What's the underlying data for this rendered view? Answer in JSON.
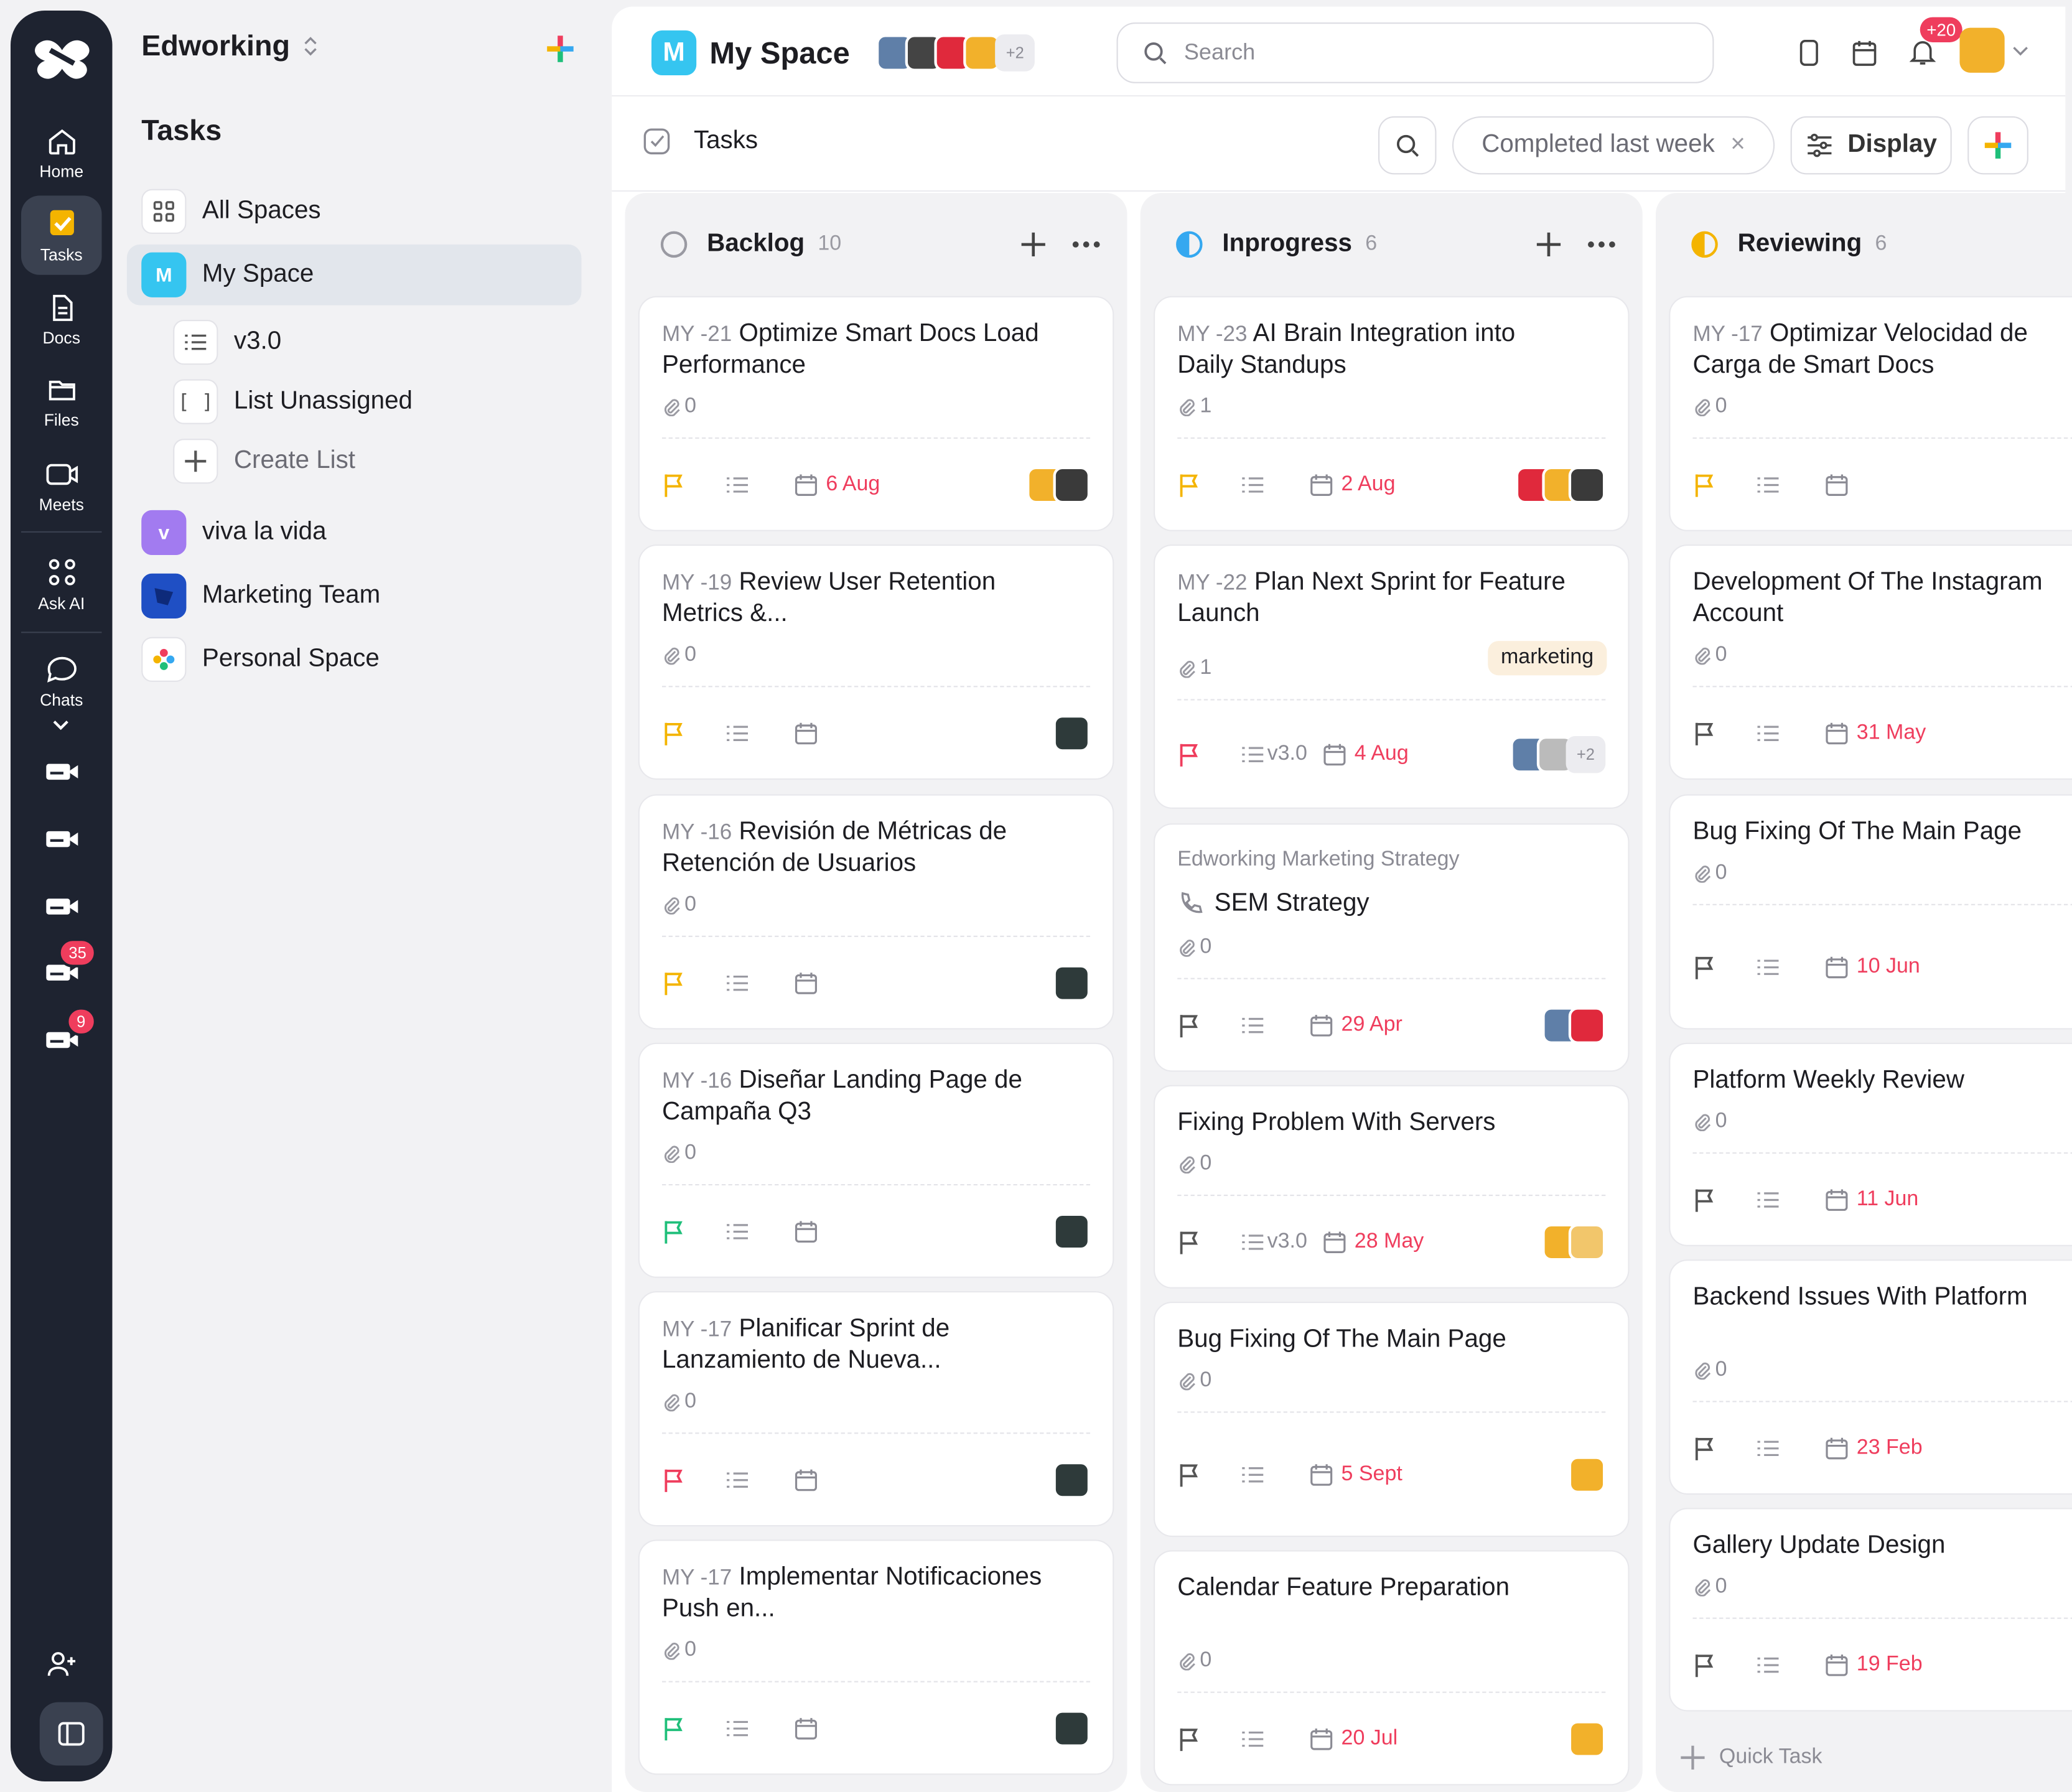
{
  "rail": {
    "items": [
      {
        "label": "Home",
        "icon": "home-icon"
      },
      {
        "label": "Tasks",
        "icon": "tasks-icon"
      },
      {
        "label": "Docs",
        "icon": "docs-icon"
      },
      {
        "label": "Files",
        "icon": "files-icon"
      },
      {
        "label": "Meets",
        "icon": "meets-icon"
      },
      {
        "label": "Ask AI",
        "icon": "ask-ai-icon"
      },
      {
        "label": "Chats",
        "icon": "chats-icon"
      }
    ],
    "badges": [
      "35",
      "9"
    ]
  },
  "sidebar": {
    "workspace": "Edworking",
    "section": "Tasks",
    "items": [
      {
        "label": "All Spaces"
      },
      {
        "label": "My Space",
        "badge": "M"
      },
      {
        "label": "v3.0"
      },
      {
        "label": "List Unassigned",
        "icon_text": "[ ]"
      },
      {
        "label": "Create List"
      },
      {
        "label": "viva la vida",
        "badge": "v"
      },
      {
        "label": "Marketing Team"
      },
      {
        "label": "Personal Space"
      }
    ]
  },
  "header": {
    "title": "My Space",
    "badge": "M",
    "members_more": "+2",
    "search_placeholder": "Search",
    "notif_badge": "+20"
  },
  "toolbar": {
    "title": "Tasks",
    "filter": "Completed last week",
    "filter_close": "×",
    "display": "Display"
  },
  "columns": [
    {
      "name": "Backlog",
      "count": "10",
      "cards": [
        {
          "id": "MY -21",
          "title": "Optimize Smart Docs Load Performance",
          "attachments": "0",
          "date": "6 Aug"
        },
        {
          "id": "MY -19",
          "title": "Review User Retention Metrics &...",
          "attachments": "0",
          "date": ""
        },
        {
          "id": "MY -16",
          "title": "Revisión de Métricas de Retención de Usuarios",
          "attachments": "0",
          "date": ""
        },
        {
          "id": "MY -16",
          "title": "Diseñar Landing Page de Campaña Q3",
          "attachments": "0",
          "date": ""
        },
        {
          "id": "MY -17",
          "title": "Planificar Sprint de Lanzamiento de Nueva...",
          "attachments": "0",
          "date": ""
        },
        {
          "id": "MY -17",
          "title": "Implementar Notificaciones Push en...",
          "attachments": "0",
          "date": ""
        }
      ]
    },
    {
      "name": "Inprogress",
      "count": "6",
      "cards": [
        {
          "id": "MY -23",
          "title": "AI Brain Integration into Daily Standups",
          "attachments": "1",
          "date": "2 Aug"
        },
        {
          "id": "MY -22",
          "title": "Plan Next Sprint for Feature Launch",
          "attachments": "1",
          "tag": "marketing",
          "list": "v3.0",
          "date": "4 Aug",
          "more": "+2"
        },
        {
          "project": "Edworking Marketing Strategy",
          "title": "SEM Strategy",
          "attachments": "0",
          "date": "29 Apr"
        },
        {
          "title": "Fixing Problem With Servers",
          "attachments": "0",
          "list": "v3.0",
          "date": "28 May"
        },
        {
          "title": "Bug Fixing Of The Main Page",
          "attachments": "0",
          "date": "5 Sept"
        },
        {
          "title": "Calendar Feature Preparation",
          "attachments": "0",
          "date": "20 Jul"
        }
      ]
    },
    {
      "name": "Reviewing",
      "count": "6",
      "quick_task": "Quick Task",
      "cards": [
        {
          "id": "MY -17",
          "title": "Optimizar Velocidad de Carga de Smart Docs",
          "attachments": "0",
          "date": ""
        },
        {
          "title": "Development Of The Instagram Account",
          "attachments": "0",
          "date": "31 May"
        },
        {
          "title": "Bug Fixing Of The Main Page",
          "attachments": "0",
          "date": "10 Jun"
        },
        {
          "title": "Platform Weekly Review",
          "attachments": "0",
          "date": "11 Jun"
        },
        {
          "title": "Backend Issues With Platform",
          "attachments": "0",
          "date": "23 Feb"
        },
        {
          "title": "Gallery Update Design",
          "attachments": "0",
          "date": "19 Feb"
        }
      ]
    }
  ],
  "colors": {
    "accent": "#35c5f0",
    "flag_yellow": "#f4b400",
    "flag_green": "#1fbf7a",
    "flag_red": "#ef3d5d",
    "date_red": "#ef3d5d",
    "rail": "#1e2330"
  }
}
